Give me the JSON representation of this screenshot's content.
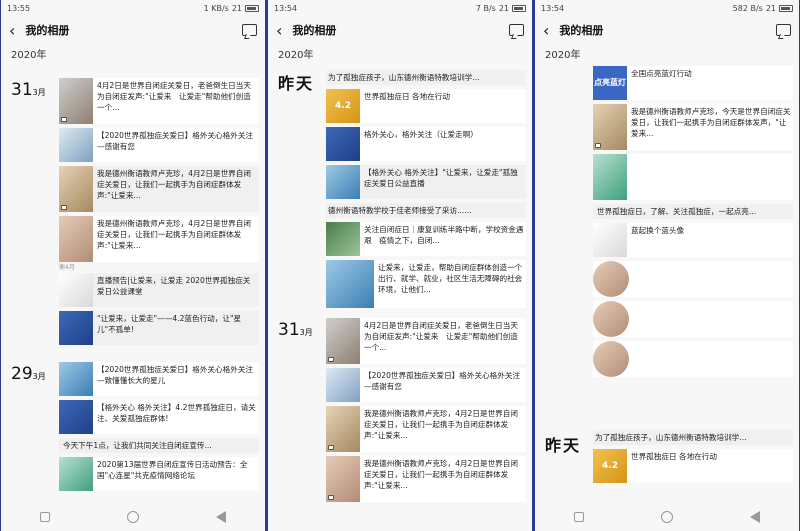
{
  "panels": [
    {
      "status_time": "13:55",
      "status_speed": "1 KB/s",
      "battery": "21"
    },
    {
      "status_time": "13:54",
      "status_speed": "7 B/s",
      "battery": "21"
    },
    {
      "status_time": "13:54",
      "status_speed": "582 B/s",
      "battery": "21"
    }
  ],
  "header": {
    "title": "我的相册",
    "back_icon": "chevron-left-icon",
    "message_icon": "message-icon"
  },
  "year": "2020年",
  "days": {
    "d31": "31",
    "d29": "29",
    "month3": "3月",
    "yesterday": "昨天"
  },
  "p1_items": [
    "4月2日是世界自闭症关爱日，老爸倒生日当天为自闭症发声:\"让爱来　让爱走\"帮助他们创造一个...",
    "【2020世界孤独症关爱日】格外关心格外关注—感谢有您",
    "我是德州衡语教师卢克珍，4月2日是世界自闭症关爱日，让我们一起携手为自闭症群体发声:\"让爱来...",
    "我是德州衡语教师卢克珍，4月2日是世界自闭症关爱日，让我们一起携手为自闭症群体发声:\"让爱来...",
    "直播预告|让爱来，让爱走 2020世界孤独症关爱日公益课堂",
    "\"让爱来，让爱走\"——4.2蓝色行动，让\"星儿\"不孤单!",
    "【2020世界孤独症关爱日】格外关心格外关注—致懂懂长大的星儿",
    "【格外关心 格外关注】4.2世界孤独症日，请关注、关爱孤独症群体!",
    "今天下午1点，让我们共同关注自闭症宣传...",
    "2020第13届世界自闭症宣传日活动预告：全国\"心连星\"共克疫情网络论坛"
  ],
  "p1_meta": "衡4月",
  "p2_items": [
    "为了孤独症孩子，山东德州衡语特教培训学...",
    "世界孤独症日 各地在行动",
    "格外关心，格外关注（让爱走啊）",
    "【格外关心 格外关注】\"让爱来，让爱走\"孤独症关爱日公益直播",
    "德州衡语特教学校于佳老师接受了采访......",
    "关注自闭症日｜康复训练半路中断，学校资金遇艰　疫情之下，自闭...",
    "让爱来，让爱走，帮助自闭症群体创造一个出行、就学、就业，社区生活无障碍的社会环境，让他们...",
    "4月2日是世界自闭症关爱日，老爸倒生日当天为自闭症发声:\"让爱来　让爱走\"帮助他们创造一个...",
    "【2020世界孤独症关爱日】格外关心格外关注—感谢有您",
    "我是德州衡语教师卢克珍，4月2日是世界自闭症关爱日，让我们一起携手为自闭症群体发声:\"让爱来...",
    "我是德州衡语教师卢克珍，4月2日是世界自闭症关爱日，让我们一起携手为自闭症群体发声:\"让爱来..."
  ],
  "p2_badge": "4.2",
  "p3_items": [
    "全国点亮蓝灯行动",
    "我是德州衡语教师卢克珍，今天是世界自闭症关爱日，让我们一起携手为自闭症群体发声，\"让爱来...",
    "世界孤独症日，了解、关注孤独症，一起点亮...",
    "蓝起换个蓝头像",
    "为了孤独症孩子，山东德州衡语特教培训学...",
    "世界孤独症日 各地在行动"
  ],
  "p3_badge": "点亮蓝灯",
  "p3_badge2": "4.2"
}
